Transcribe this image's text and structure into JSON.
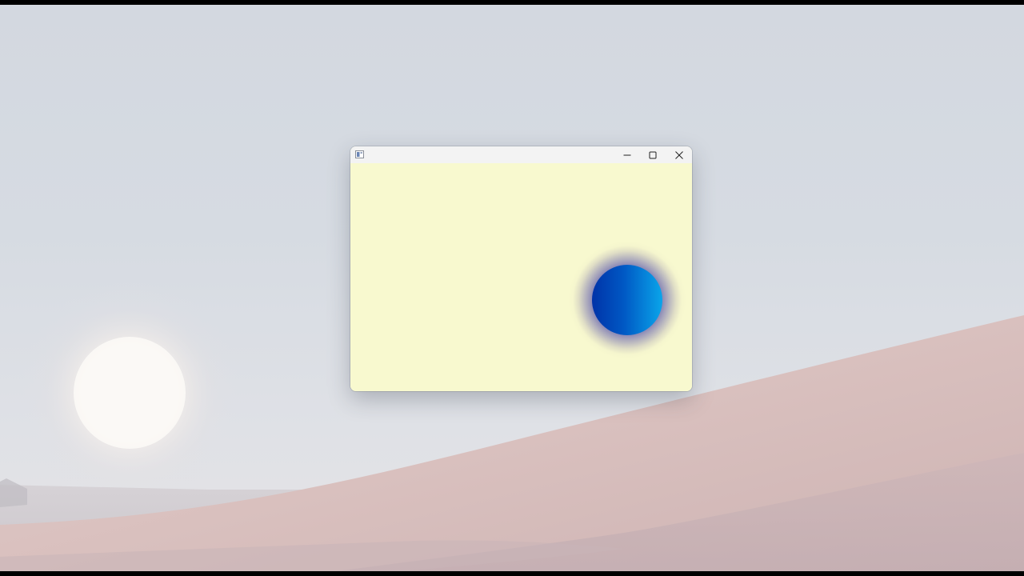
{
  "desktop": {
    "wallpaper": "sand-dunes-with-sun",
    "colors": {
      "sky": "#d6dbe2",
      "dune": "#d9c1bf",
      "sun": "#fbf8f4"
    }
  },
  "window": {
    "title": "",
    "app_icon": "window-app-icon",
    "controls": {
      "minimize": "minimize-icon",
      "maximize": "maximize-icon",
      "close": "close-icon"
    },
    "client_background": "#f8f9cf",
    "ball": {
      "shape": "circle",
      "gradient_colors": [
        "#0033a8",
        "#0aa5ea"
      ],
      "glow_color": "#3a3aa0"
    }
  }
}
